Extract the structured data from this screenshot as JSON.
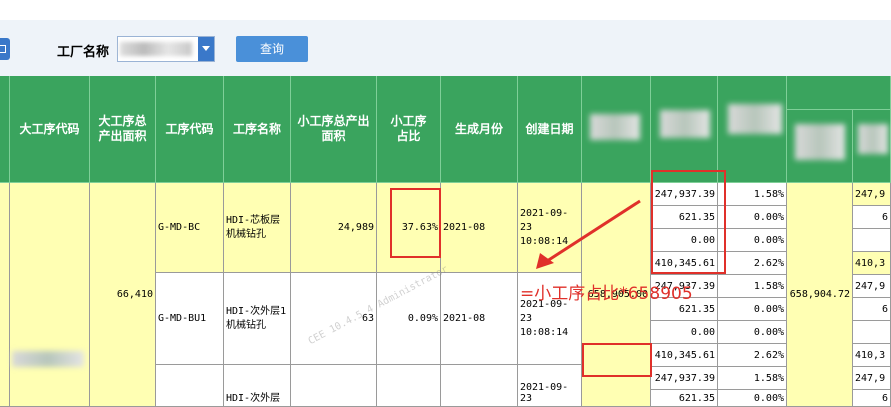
{
  "toolbar": {
    "factory_label": "工厂名称",
    "query_label": "查询"
  },
  "headers": {
    "major_code": "大工序代码",
    "major_area": "大工序总产出面积",
    "proc_code": "工序代码",
    "proc_name": "工序名称",
    "sub_area": "小工序总产出面积",
    "sub_ratio": "小工序占比",
    "month": "生成月份",
    "created": "创建日期"
  },
  "rows": {
    "major_area_value": "66,410",
    "r1": {
      "code": "G-MD-BC",
      "name": "HDI-芯板层机械钻孔",
      "area": "24,989",
      "ratio": "37.63%",
      "month": "2021-08",
      "created": "2021-09-23 10:08:14"
    },
    "r2": {
      "code": "G-MD-BU1",
      "name": "HDI-次外层1机械钻孔",
      "area": "63",
      "ratio": "0.09%",
      "month": "2021-08",
      "created": "2021-09-23 10:08:14"
    },
    "r3": {
      "name": "HDI-次外层",
      "created": "2021-09-23"
    }
  },
  "detail": {
    "values": [
      "247,937.39",
      "621.35",
      "0.00",
      "410,345.61",
      "247,937.39",
      "621.35",
      "0.00",
      "410,345.61",
      "247,937.39",
      "621.35"
    ],
    "percents": [
      "1.58%",
      "0.00%",
      "0.00%",
      "2.62%",
      "1.58%",
      "0.00%",
      "0.00%",
      "2.62%",
      "1.58%",
      "0.00%"
    ],
    "total_left": "658,905.00",
    "total_right": "658,904.72",
    "right_values": [
      "247,9",
      "6",
      "",
      "410,3",
      "247,9",
      "6",
      "",
      "410,3",
      "247,9",
      "6"
    ]
  },
  "annotation": {
    "formula": "=小工序占比*658905"
  },
  "watermark": "CEE 10.4.5.4 Administrator"
}
